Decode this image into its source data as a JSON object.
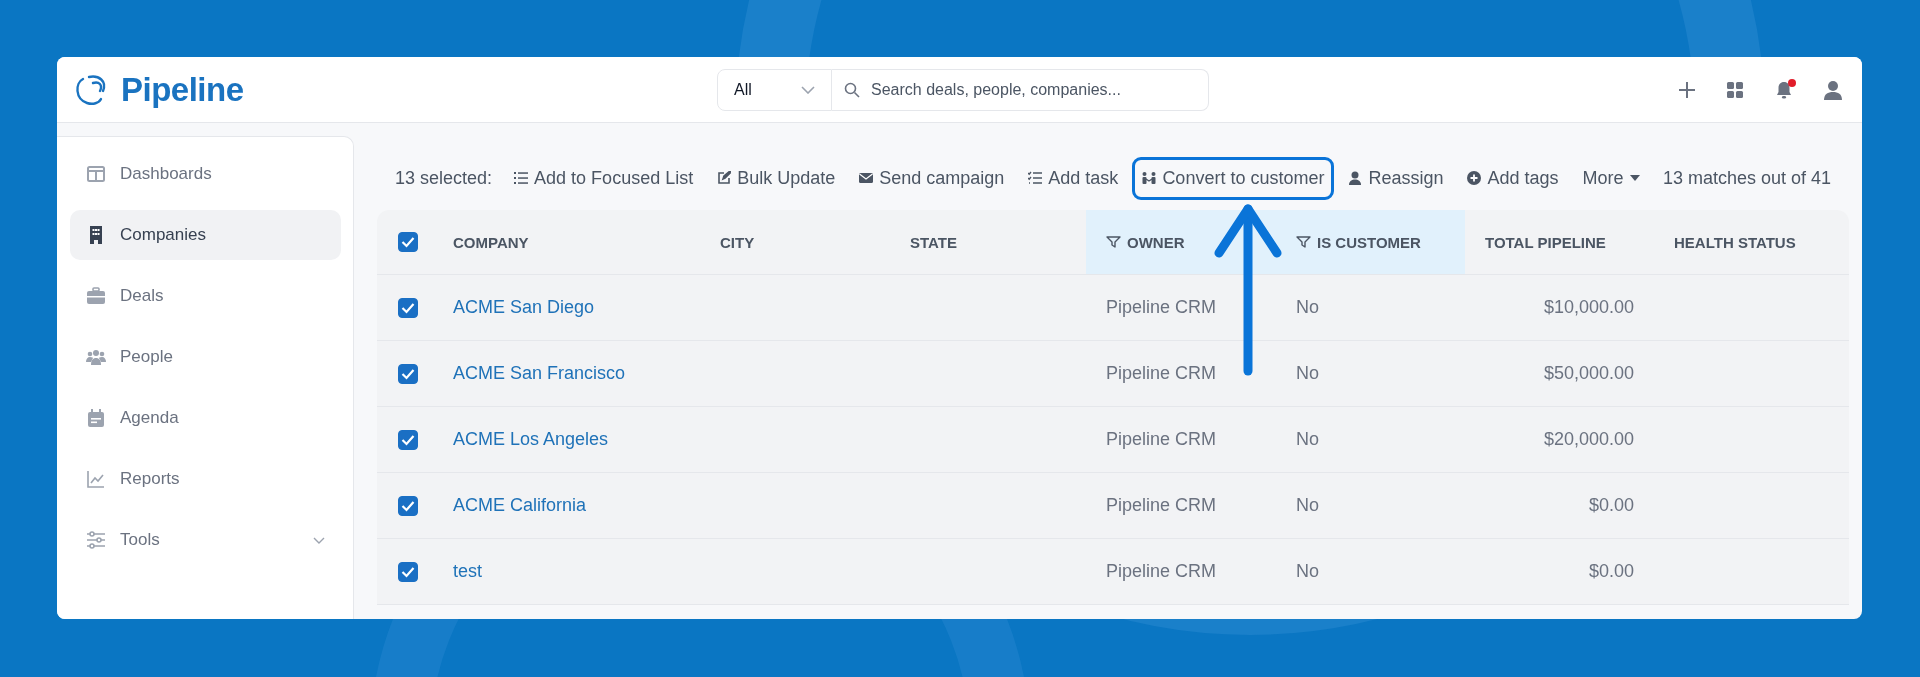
{
  "header": {
    "logo": "Pipeline",
    "search_scope": "All",
    "search_placeholder": "Search deals, people, companies...",
    "notification_unread": true
  },
  "sidebar": {
    "items": [
      {
        "label": "Dashboards",
        "selected": false,
        "expandable": false
      },
      {
        "label": "Companies",
        "selected": true,
        "expandable": false
      },
      {
        "label": "Deals",
        "selected": false,
        "expandable": false
      },
      {
        "label": "People",
        "selected": false,
        "expandable": false
      },
      {
        "label": "Agenda",
        "selected": false,
        "expandable": false
      },
      {
        "label": "Reports",
        "selected": false,
        "expandable": false
      },
      {
        "label": "Tools",
        "selected": false,
        "expandable": true
      }
    ]
  },
  "bulk_bar": {
    "selected_label": "13 selected:",
    "actions": [
      {
        "label": "Add to Focused List",
        "highlighted": false
      },
      {
        "label": "Bulk Update",
        "highlighted": false
      },
      {
        "label": "Send campaign",
        "highlighted": false
      },
      {
        "label": "Add task",
        "highlighted": false
      },
      {
        "label": "Convert to customer",
        "highlighted": true
      },
      {
        "label": "Reassign",
        "highlighted": false
      },
      {
        "label": "Add tags",
        "highlighted": false
      }
    ],
    "more": "More",
    "match_count": "13 matches out of 41"
  },
  "table": {
    "all_checked": true,
    "columns": [
      {
        "label": "COMPANY",
        "filtered": false
      },
      {
        "label": "CITY",
        "filtered": false
      },
      {
        "label": "STATE",
        "filtered": false
      },
      {
        "label": "OWNER",
        "filtered": true
      },
      {
        "label": "IS CUSTOMER",
        "filtered": true
      },
      {
        "label": "TOTAL PIPELINE",
        "filtered": false
      },
      {
        "label": "HEALTH STATUS",
        "filtered": false
      }
    ],
    "rows": [
      {
        "checked": true,
        "company": "ACME San Diego",
        "owner": "Pipeline CRM",
        "is_customer": "No",
        "total_pipeline": "$10,000.00"
      },
      {
        "checked": true,
        "company": "ACME San Francisco",
        "owner": "Pipeline CRM",
        "is_customer": "No",
        "total_pipeline": "$50,000.00"
      },
      {
        "checked": true,
        "company": "ACME Los Angeles",
        "owner": "Pipeline CRM",
        "is_customer": "No",
        "total_pipeline": "$20,000.00"
      },
      {
        "checked": true,
        "company": "ACME California",
        "owner": "Pipeline CRM",
        "is_customer": "No",
        "total_pipeline": "$0.00"
      },
      {
        "checked": true,
        "company": "test",
        "owner": "Pipeline CRM",
        "is_customer": "No",
        "total_pipeline": "$0.00"
      }
    ]
  }
}
